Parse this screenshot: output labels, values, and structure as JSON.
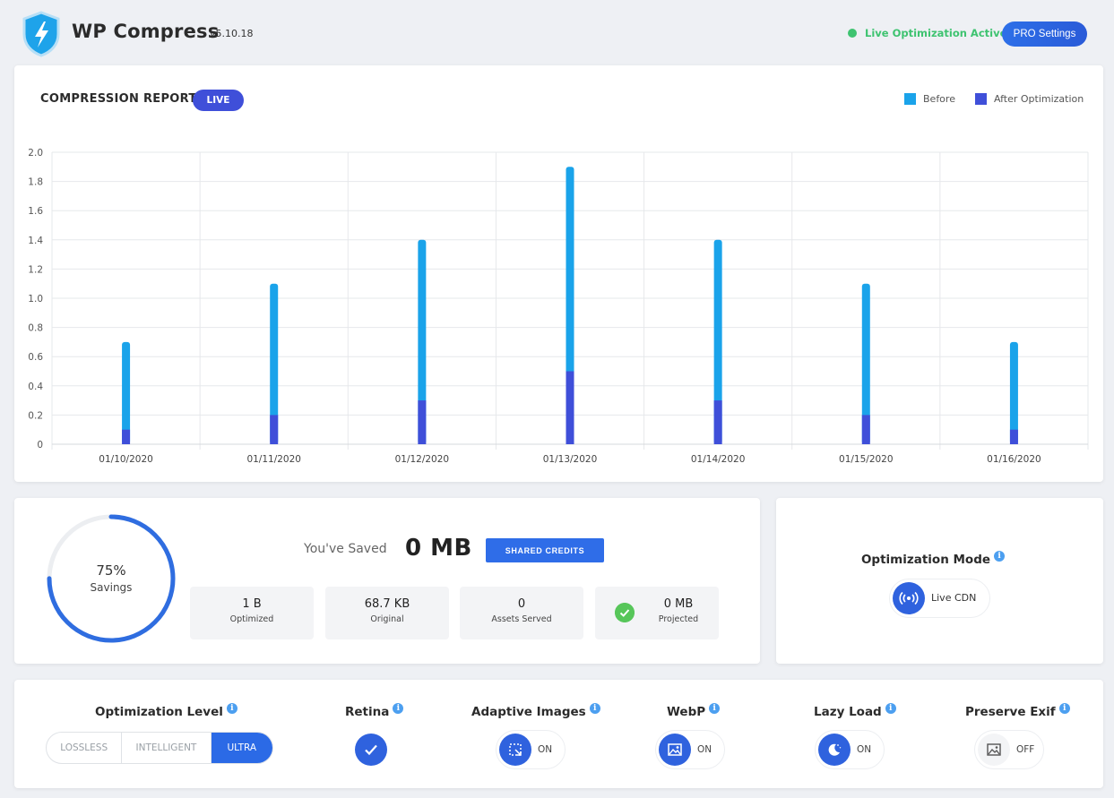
{
  "header": {
    "brand": "WP Compress",
    "version": "v5.10.18",
    "live_status": "Live Optimization Active",
    "pro_settings": "PRO Settings"
  },
  "colors": {
    "before": "#1aa3ea",
    "after": "#3f4fd9",
    "accent": "#2f62de",
    "live_green": "#3ec370"
  },
  "report": {
    "title": "COMPRESSION REPORT",
    "badge": "LIVE",
    "legend_before": "Before",
    "legend_after": "After Optimization"
  },
  "chart_data": {
    "type": "bar",
    "stacked": "overlay",
    "categories": [
      "01/10/2020",
      "01/11/2020",
      "01/12/2020",
      "01/13/2020",
      "01/14/2020",
      "01/15/2020",
      "01/16/2020"
    ],
    "series": [
      {
        "name": "Before",
        "values": [
          0.7,
          1.1,
          1.4,
          1.9,
          1.4,
          1.1,
          0.7
        ]
      },
      {
        "name": "After Optimization",
        "values": [
          0.1,
          0.2,
          0.3,
          0.5,
          0.3,
          0.2,
          0.1
        ]
      }
    ],
    "ylim": [
      0,
      2.0
    ],
    "yticks": [
      "2.0",
      "1.8",
      "1.6",
      "1.4",
      "1.2",
      "1.0",
      "0.8",
      "0.6",
      "0.4",
      "0.2",
      "0"
    ],
    "grid": true,
    "legend_position": "top-right"
  },
  "savings": {
    "percent": "75%",
    "percent_value": 0.75,
    "label": "Savings",
    "saved_label": "You've Saved",
    "saved_value": "0 MB",
    "credits_button": "SHARED CREDITS",
    "stats": [
      {
        "value": "1 B",
        "label": "Optimized"
      },
      {
        "value": "68.7 KB",
        "label": "Original"
      },
      {
        "value": "0",
        "label": "Assets Served"
      },
      {
        "value": "0 MB",
        "label": "Projected"
      }
    ]
  },
  "mode": {
    "title": "Optimization Mode",
    "value": "Live CDN"
  },
  "settings": {
    "level_title": "Optimization Level",
    "levels": [
      "LOSSLESS",
      "INTELLIGENT",
      "ULTRA"
    ],
    "active_level": "ULTRA",
    "retina": "Retina",
    "adaptive": "Adaptive Images",
    "adaptive_state": "ON",
    "webp": "WebP",
    "webp_state": "ON",
    "lazy": "Lazy Load",
    "lazy_state": "ON",
    "exif": "Preserve Exif",
    "exif_state": "OFF"
  }
}
